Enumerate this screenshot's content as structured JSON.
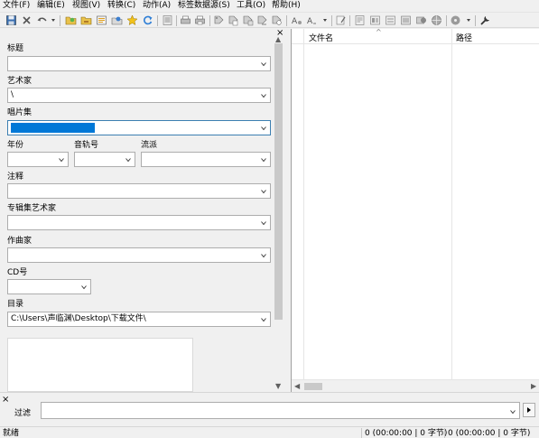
{
  "menu": [
    "文件(F)",
    "编辑(E)",
    "视图(V)",
    "转换(C)",
    "动作(A)",
    "标签数据源(S)",
    "工具(O)",
    "帮助(H)"
  ],
  "toolbar": {
    "icons": [
      "save-icon",
      "delete-icon",
      "undo-icon",
      "open-folder-icon",
      "open-folder-tree-icon",
      "save-playlist-icon",
      "export-icon",
      "favorite-icon",
      "refresh-icon",
      "list-icon",
      "print-icon",
      "print-preview-icon",
      "tag-to-filename-icon",
      "filename-to-tag-icon",
      "tag-to-tag-icon",
      "text-to-tag-icon",
      "tag-to-filename-advanced-icon",
      "case-conversion-icon",
      "text-format-icon",
      "edit-note-icon",
      "export-playlist-icon",
      "filter-icon",
      "options-icon",
      "tag-panel-icon",
      "playlist-icon",
      "disc-icon",
      "tools-icon"
    ]
  },
  "tag_panel": {
    "close": "×",
    "title_label": "标题",
    "title_value": "",
    "artist_label": "艺术家",
    "artist_value": "\\",
    "album_label": "唱片集",
    "album_value": "",
    "year_label": "年份",
    "year_value": "",
    "track_label": "音轨号",
    "track_value": "",
    "genre_label": "流派",
    "genre_value": "",
    "comment_label": "注释",
    "comment_value": "",
    "album_artist_label": "专辑集艺术家",
    "album_artist_value": "",
    "composer_label": "作曲家",
    "composer_value": "",
    "disc_label": "CD号",
    "disc_value": "",
    "directory_label": "目录",
    "directory_value": "C:\\Users\\声临渊\\Desktop\\下载文件\\"
  },
  "file_list": {
    "columns": [
      "文件名",
      "路径"
    ],
    "sort_glyph": "^"
  },
  "filter": {
    "close": "×",
    "label": "过滤",
    "value": ""
  },
  "status": {
    "ready": "就绪",
    "selected": "0 (00:00:00 | 0 字节)",
    "total": "0 (00:00:00 | 0 字节)"
  }
}
